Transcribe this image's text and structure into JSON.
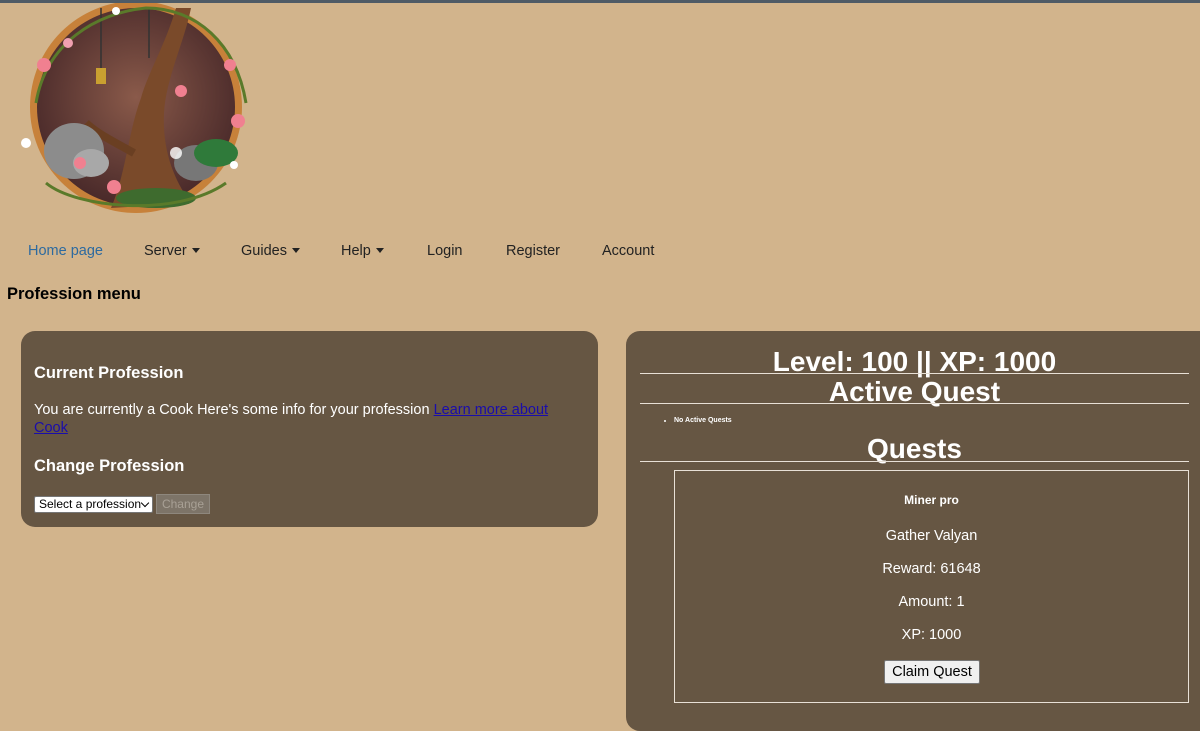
{
  "logo": {
    "icon": "fantasy-tree-logo"
  },
  "nav": {
    "items": [
      {
        "label": "Home page",
        "dropdown": false,
        "active": true
      },
      {
        "label": "Server",
        "dropdown": true
      },
      {
        "label": "Guides",
        "dropdown": true
      },
      {
        "label": "Help",
        "dropdown": true
      },
      {
        "label": "Login",
        "dropdown": false
      },
      {
        "label": "Register",
        "dropdown": false
      },
      {
        "label": "Account",
        "dropdown": false
      }
    ]
  },
  "page": {
    "title": "Profession menu"
  },
  "profession": {
    "current_heading": "Current Profession",
    "current_text": "You are currently a Cook Here's some info for your profession ",
    "learn_more_link": "Learn more about Cook",
    "change_heading": "Change Profession",
    "select_value": "Select a profession",
    "change_button": "Change"
  },
  "stats": {
    "level_xp": "Level: 100 || XP: 1000",
    "active_quest_heading": "Active Quest",
    "no_active_quests": "No Active Quests",
    "quests_heading": "Quests"
  },
  "quest": {
    "title": "Miner pro",
    "task": "Gather Valyan",
    "reward": "Reward: 61648",
    "amount": "Amount: 1",
    "xp": "XP: 1000",
    "claim_button": "Claim Quest"
  },
  "colors": {
    "background": "#d2b48c",
    "panel": "#665643",
    "active_nav": "#2d6a9f",
    "link": "#1a0dab"
  }
}
